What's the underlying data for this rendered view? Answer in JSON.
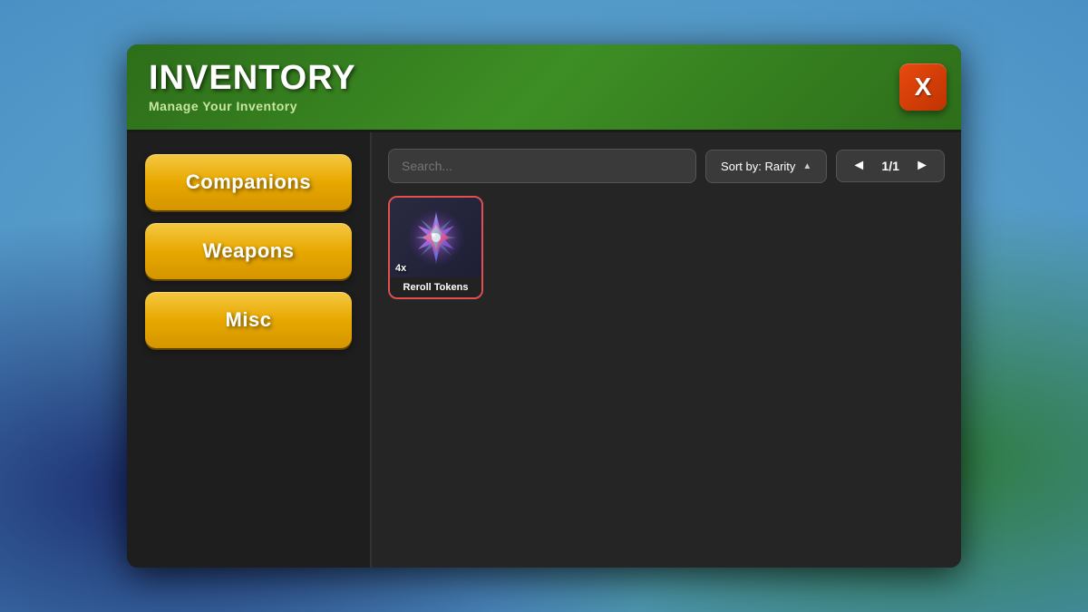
{
  "background": {
    "color": "#5a8fc2"
  },
  "modal": {
    "title": "INVENTORY",
    "subtitle": "Manage Your Inventory",
    "close_label": "X"
  },
  "sidebar": {
    "nav_items": [
      {
        "id": "companions",
        "label": "Companions"
      },
      {
        "id": "weapons",
        "label": "Weapons"
      },
      {
        "id": "misc",
        "label": "Misc"
      }
    ]
  },
  "toolbar": {
    "search_placeholder": "Search...",
    "sort_label": "Sort by: Rarity",
    "sort_direction": "▲",
    "page_prev": "◄",
    "page_next": "►",
    "page_current": "1/1"
  },
  "items": [
    {
      "id": "reroll-tokens",
      "label": "Reroll Tokens",
      "quantity": "4x",
      "selected": true
    }
  ]
}
